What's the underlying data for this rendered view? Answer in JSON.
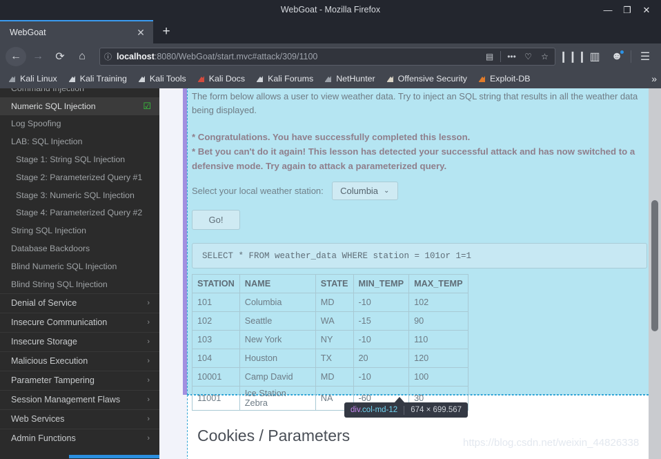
{
  "window": {
    "title": "WebGoat - Mozilla Firefox",
    "minimize": "—",
    "maximize": "❐",
    "close": "✕"
  },
  "tabbar": {
    "tab_title": "WebGoat",
    "close_label": "✕",
    "newtab_label": "+"
  },
  "navbar": {
    "back": "←",
    "forward": "→",
    "reload": "⟳",
    "home": "⌂",
    "url_host": "localhost",
    "url_rest": ":8080/WebGoat/start.mvc#attack/309/1100",
    "info_icon": "ⓘ",
    "reader_icon": "▤",
    "more_icon": "•••",
    "pocket_icon": "♡",
    "star_icon": "☆",
    "library_icon": "❙❙❙",
    "sidebar_icon": "▥",
    "account_icon": "☻",
    "menu_icon": "☰"
  },
  "bookmarks": {
    "items": [
      {
        "label": "Kali Linux",
        "icon": "dragon-icon",
        "color": "#9aa0a8"
      },
      {
        "label": "Kali Training",
        "icon": "pen-icon",
        "color": "#cfd3d8"
      },
      {
        "label": "Kali Tools",
        "icon": "pen-icon",
        "color": "#cfd3d8"
      },
      {
        "label": "Kali Docs",
        "icon": "docs-icon",
        "color": "#d24b3e"
      },
      {
        "label": "Kali Forums",
        "icon": "pen-icon",
        "color": "#cfd3d8"
      },
      {
        "label": "NetHunter",
        "icon": "dragon-icon",
        "color": "#9aa0a8"
      },
      {
        "label": "Offensive Security",
        "icon": "offsec-icon",
        "color": "#d8d2c4"
      },
      {
        "label": "Exploit-DB",
        "icon": "flame-icon",
        "color": "#e07b2a"
      }
    ],
    "overflow": "»"
  },
  "sidebar": {
    "lessons": [
      {
        "label": "Command Injection",
        "active": false,
        "sub": false,
        "cut": true
      },
      {
        "label": "Numeric SQL Injection",
        "active": true,
        "sub": false,
        "check": "☑"
      },
      {
        "label": "Log Spoofing",
        "active": false,
        "sub": false
      },
      {
        "label": "LAB: SQL Injection",
        "active": false,
        "sub": false
      },
      {
        "label": "Stage 1: String SQL Injection",
        "active": false,
        "sub": true
      },
      {
        "label": "Stage 2: Parameterized Query #1",
        "active": false,
        "sub": true
      },
      {
        "label": "Stage 3: Numeric SQL Injection",
        "active": false,
        "sub": true
      },
      {
        "label": "Stage 4: Parameterized Query #2",
        "active": false,
        "sub": true
      },
      {
        "label": "String SQL Injection",
        "active": false,
        "sub": false
      },
      {
        "label": "Database Backdoors",
        "active": false,
        "sub": false
      },
      {
        "label": "Blind Numeric SQL Injection",
        "active": false,
        "sub": false
      },
      {
        "label": "Blind String SQL Injection",
        "active": false,
        "sub": false
      }
    ],
    "groups": [
      {
        "label": "Denial of Service",
        "chevron": "›"
      },
      {
        "label": "Insecure Communication",
        "chevron": "›"
      },
      {
        "label": "Insecure Storage",
        "chevron": "›"
      },
      {
        "label": "Malicious Execution",
        "chevron": "›"
      },
      {
        "label": "Parameter Tampering",
        "chevron": "›"
      },
      {
        "label": "Session Management Flaws",
        "chevron": "›"
      },
      {
        "label": "Web Services",
        "chevron": "›"
      },
      {
        "label": "Admin Functions",
        "chevron": "›"
      }
    ]
  },
  "lesson": {
    "intro": "The form below allows a user to view weather data. Try to inject an SQL string that results in all the weather data being displayed.",
    "success_line1": "* Congratulations. You have successfully completed this lesson.",
    "success_line2": "* Bet you can't do it again! This lesson has detected your successful attack and has now switched to a defensive mode. Try again to attack a parameterized query.",
    "station_label": "Select your local weather station:",
    "station_value": "Columbia",
    "station_chevron": "⌄",
    "go_label": "Go!",
    "sql": "SELECT * FROM weather_data WHERE station = 101or 1=1"
  },
  "table": {
    "headers": [
      "STATION",
      "NAME",
      "STATE",
      "MIN_TEMP",
      "MAX_TEMP"
    ],
    "rows": [
      [
        "101",
        "Columbia",
        "MD",
        "-10",
        "102"
      ],
      [
        "102",
        "Seattle",
        "WA",
        "-15",
        "90"
      ],
      [
        "103",
        "New York",
        "NY",
        "-10",
        "110"
      ],
      [
        "104",
        "Houston",
        "TX",
        "20",
        "120"
      ],
      [
        "10001",
        "Camp David",
        "MD",
        "-10",
        "100"
      ],
      [
        "11001",
        "Ice Station Zebra",
        "NA",
        "-60",
        "30"
      ]
    ]
  },
  "devtools_tooltip": {
    "tag": "div",
    "class": ".col-md-12",
    "size": "674 × 699.567"
  },
  "next_section": {
    "heading": "Cookies / Parameters"
  },
  "watermark": {
    "text": "https://blog.csdn.net/weixin_44826338"
  },
  "colors": {
    "accent_blue": "#3b9bf0",
    "highlight_fill": "#b5e5f2",
    "highlight_border": "#2ea3d4",
    "margin_purple": "#a28fe0",
    "check_green": "#36d03a"
  }
}
